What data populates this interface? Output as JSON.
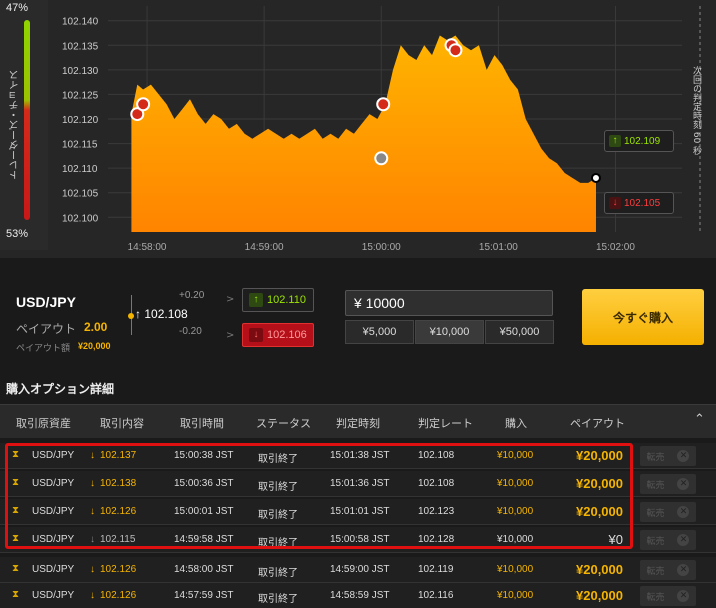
{
  "ratio": {
    "top": "47%",
    "bottom": "53%",
    "label": "トレーダーズ・チョイス",
    "high_share": 0.47
  },
  "chart": {
    "y_ticks": [
      "102.140",
      "102.135",
      "102.130",
      "102.125",
      "102.120",
      "102.115",
      "102.110",
      "102.105",
      "102.100"
    ],
    "x_ticks": [
      "14:58:00",
      "14:59:00",
      "15:00:00",
      "15:01:00",
      "15:02:00"
    ],
    "next_judgment": "次回の判定時刻 60 秒",
    "high_tag": "102.109",
    "low_tag": "102.105",
    "colors": {
      "area_top": "#ffb000",
      "area_bottom": "#ff8a00",
      "background": "#262626"
    }
  },
  "chart_data": {
    "type": "area",
    "x": [
      "14:57:52",
      "14:57:55",
      "14:57:58",
      "14:58:02",
      "14:58:06",
      "14:58:10",
      "14:58:14",
      "14:58:18",
      "14:58:22",
      "14:58:26",
      "14:58:30",
      "14:58:34",
      "14:58:38",
      "14:58:42",
      "14:58:46",
      "14:58:50",
      "14:58:54",
      "14:58:58",
      "14:59:02",
      "14:59:06",
      "14:59:10",
      "14:59:14",
      "14:59:18",
      "14:59:22",
      "14:59:26",
      "14:59:30",
      "14:59:34",
      "14:59:38",
      "14:59:42",
      "14:59:46",
      "14:59:50",
      "14:59:54",
      "14:59:58",
      "15:00:02",
      "15:00:06",
      "15:00:10",
      "15:00:14",
      "15:00:18",
      "15:00:22",
      "15:00:26",
      "15:00:30",
      "15:00:34",
      "15:00:38",
      "15:00:42",
      "15:00:46",
      "15:00:50",
      "15:00:54",
      "15:00:58",
      "15:01:02",
      "15:01:06",
      "15:01:10",
      "15:01:14",
      "15:01:18",
      "15:01:22",
      "15:01:26",
      "15:01:30",
      "15:01:34",
      "15:01:38",
      "15:01:42",
      "15:01:46",
      "15:01:50"
    ],
    "values": [
      102.121,
      102.127,
      102.126,
      102.127,
      102.125,
      102.123,
      102.12,
      102.122,
      102.124,
      102.121,
      102.119,
      102.121,
      102.12,
      102.118,
      102.119,
      102.117,
      102.116,
      102.117,
      102.118,
      102.117,
      102.116,
      102.117,
      102.116,
      102.117,
      102.118,
      102.116,
      102.117,
      102.116,
      102.118,
      102.117,
      102.119,
      102.121,
      102.12,
      102.123,
      102.13,
      102.135,
      102.133,
      102.132,
      102.135,
      102.133,
      102.137,
      102.136,
      102.137,
      102.135,
      102.134,
      102.135,
      102.13,
      102.133,
      102.131,
      102.128,
      102.126,
      102.12,
      102.117,
      102.114,
      102.112,
      102.111,
      102.109,
      102.108,
      102.107,
      102.107,
      102.108
    ],
    "ylim": [
      102.097,
      102.143
    ],
    "y_ticks": [
      102.14,
      102.135,
      102.13,
      102.125,
      102.12,
      102.115,
      102.11,
      102.105,
      102.1
    ],
    "x_ticks": [
      "14:58:00",
      "14:59:00",
      "15:00:00",
      "15:01:00",
      "15:02:00"
    ],
    "grid": true
  },
  "trade": {
    "pair": "USD/JPY",
    "payout_label": "ペイアウト",
    "payout_value": "2.00",
    "payout_amount_label": "ペイアウト額",
    "payout_amount_value": "¥20,000",
    "strike_value": "102.108",
    "strike_plus": "+0.20",
    "strike_minus": "-0.20",
    "high_btn": "102.110",
    "low_btn": "102.106",
    "amount": "¥ 10000",
    "amount_options": [
      "¥5,000",
      "¥10,000",
      "¥50,000"
    ],
    "buy_now": "今すぐ購入"
  },
  "options": {
    "title": "購入オプション詳細",
    "headers": [
      "取引原資産",
      "取引内容",
      "取引時間",
      "ステータス",
      "判定時刻",
      "判定レート",
      "購入",
      "ペイアウト"
    ],
    "resell_label": "転売",
    "rows": [
      {
        "asset": "USD/JPY",
        "arrow": "↓",
        "entry": "102.137",
        "time": "15:00:38 JST",
        "status": "取引終了",
        "judge": "15:01:38 JST",
        "rate": "102.108",
        "amount": "¥10,000",
        "payout": "¥20,000"
      },
      {
        "asset": "USD/JPY",
        "arrow": "↓",
        "entry": "102.138",
        "time": "15:00:36 JST",
        "status": "取引終了",
        "judge": "15:01:36 JST",
        "rate": "102.108",
        "amount": "¥10,000",
        "payout": "¥20,000"
      },
      {
        "asset": "USD/JPY",
        "arrow": "↓",
        "entry": "102.126",
        "time": "15:00:01 JST",
        "status": "取引終了",
        "judge": "15:01:01 JST",
        "rate": "102.123",
        "amount": "¥10,000",
        "payout": "¥20,000"
      },
      {
        "asset": "USD/JPY",
        "arrow": "↓",
        "entry": "102.115",
        "time": "14:59:58 JST",
        "status": "取引終了",
        "judge": "15:00:58 JST",
        "rate": "102.128",
        "amount": "¥10,000",
        "payout": "¥0"
      },
      {
        "asset": "USD/JPY",
        "arrow": "↓",
        "entry": "102.126",
        "time": "14:58:00 JST",
        "status": "取引終了",
        "judge": "14:59:00 JST",
        "rate": "102.119",
        "amount": "¥10,000",
        "payout": "¥20,000"
      },
      {
        "asset": "USD/JPY",
        "arrow": "↓",
        "entry": "102.126",
        "time": "14:57:59 JST",
        "status": "取引終了",
        "judge": "14:58:59 JST",
        "rate": "102.116",
        "amount": "¥10,000",
        "payout": "¥20,000"
      }
    ]
  }
}
